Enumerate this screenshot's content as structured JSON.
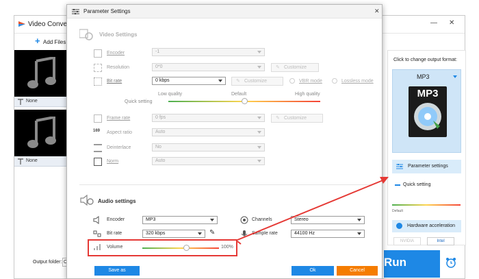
{
  "app": {
    "title": "Video Converter",
    "add_files_label": "Add Files",
    "files": [
      {
        "subtitle": "None"
      },
      {
        "subtitle": "None"
      }
    ],
    "output_folder_label": "Output folder:",
    "output_folder_value": "C",
    "run_label": "Run",
    "min_glyph": "—",
    "close_glyph": "✕"
  },
  "right_panel": {
    "click_to_change": "Click to change output format:",
    "format": "MP3",
    "format_badge": "MP3",
    "parameter_settings_label": "Parameter settings",
    "quick_setting_label": "Quick setting",
    "default_label": "Default",
    "hardware_accel_label": "Hardware acceleration",
    "nvidia_label": "NVIDIA",
    "intel_label": "Intel"
  },
  "dialog": {
    "title": "Parameter Settings",
    "close_glyph": "✕",
    "video_settings_heading": "Video Settings",
    "audio_settings_heading": "Audio settings",
    "video": {
      "encoder_label": "Encoder",
      "encoder_value": "-1",
      "resolution_label": "Resolution",
      "resolution_value": "0*0",
      "customize_label": "Customize",
      "bitrate_label": "Bit rate",
      "bitrate_value": "0 kbps",
      "bitrate_customize_label": "Customize",
      "vbr_label": "VBR mode",
      "lossless_label": "Lossless mode",
      "quick_setting_label": "Quick setting",
      "low_quality_label": "Low quality",
      "default_label": "Default",
      "high_quality_label": "High quality",
      "quality_level": 0.5,
      "framerate_label": "Frame rate",
      "framerate_value": "0 fps",
      "framerate_customize_label": "Customize",
      "aspect_label": "Aspect ratio",
      "aspect_value": "Auto",
      "deinterlace_label": "Deinterlace",
      "deinterlace_value": "No",
      "norm_label": "Norm",
      "norm_value": "Auto"
    },
    "audio": {
      "encoder_label": "Encoder",
      "encoder_value": "MP3",
      "channels_label": "Channels",
      "channels_value": "Stereo",
      "bitrate_label": "Bit rate",
      "bitrate_value": "320 kbps",
      "samplerate_label": "Sample rate",
      "samplerate_value": "44100 Hz",
      "volume_label": "Volume",
      "volume_value": "100%",
      "volume_level": 0.5
    },
    "save_as_label": "Save as",
    "ok_label": "Ok",
    "cancel_label": "Cancel"
  },
  "colors": {
    "accent_blue": "#1e88e5",
    "run_blue": "#1e88e5",
    "highlight_red": "#e53935",
    "panel_blue_bg": "#cfe5f7"
  }
}
